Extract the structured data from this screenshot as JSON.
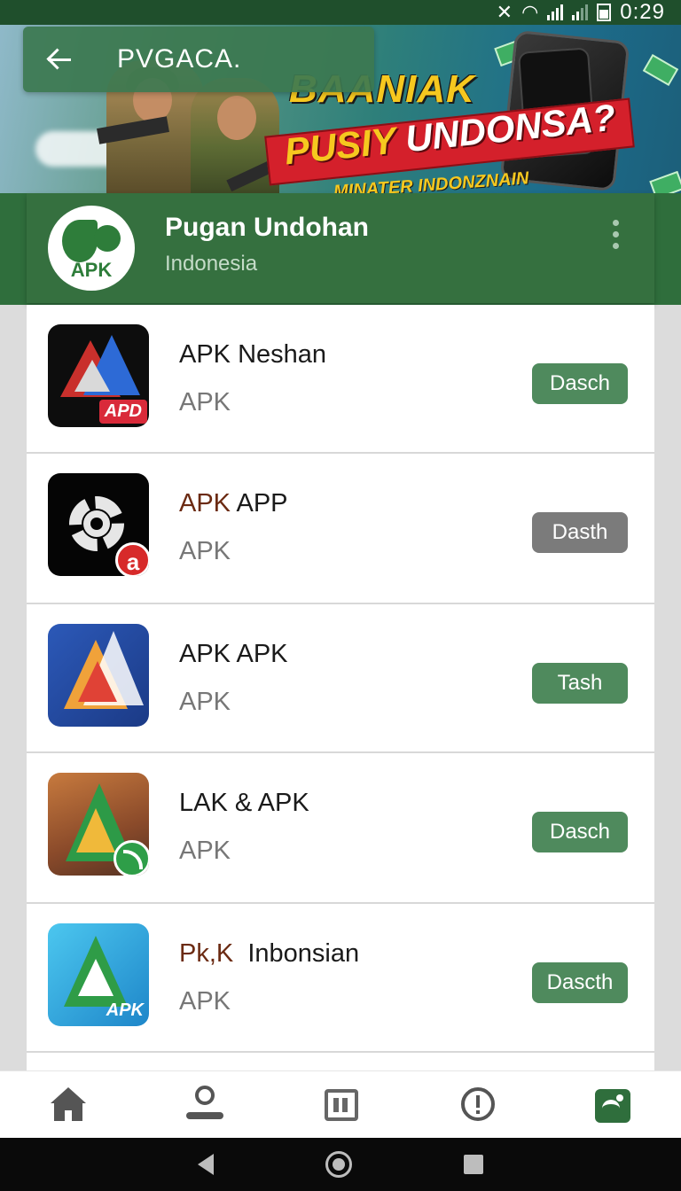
{
  "status_bar": {
    "time": "0:29",
    "icons": [
      "mute-icon",
      "wifi-icon",
      "signal-icon",
      "signal-icon",
      "battery-icon"
    ]
  },
  "top_bar": {
    "back_icon": "arrow-left-icon",
    "title": "PVGACA."
  },
  "banner": {
    "headline_1": "BAANIAK",
    "headline_2_prefix": "PUSIY",
    "headline_2_rest": " UNDONSA?",
    "headline_3": "MINATER INDONZNAIN"
  },
  "profile": {
    "logo_text": "APK",
    "name": "Pugan Undohan",
    "subtitle": "Indonesia",
    "menu_icon": "more-vertical-icon"
  },
  "apps": [
    {
      "name": "APK Neshan",
      "name_prefix": "",
      "sub": "APK",
      "button": "Dasch",
      "button_color": "#4f8a5d",
      "icon_badge": "APD"
    },
    {
      "name": " APP",
      "name_prefix": "APK",
      "sub": "APK",
      "button": "Dasth",
      "button_color": "#7b7b7b",
      "icon_badge": "a"
    },
    {
      "name": "APK APK",
      "name_prefix": "",
      "sub": "APK",
      "button": "Tash",
      "button_color": "#4f8a5d",
      "icon_badge": ""
    },
    {
      "name": "LAK & APK",
      "name_prefix": "",
      "sub": "APK",
      "button": "Dasch",
      "button_color": "#4f8a5d",
      "icon_badge": ""
    },
    {
      "name": "  Inbonsian",
      "name_prefix": "Pk,K",
      "sub": "APK",
      "button": "Dascth",
      "button_color": "#4f8a5d",
      "icon_badge": "APK"
    }
  ],
  "bottom_nav": {
    "items": [
      "home-icon",
      "profile-icon",
      "calendar-icon",
      "alert-icon",
      "store-icon"
    ],
    "active": "store-icon"
  },
  "system_nav": [
    "back-icon",
    "home-icon",
    "recents-icon"
  ],
  "colors": {
    "primary_green": "#2f6e3c",
    "button_green": "#4f8a5d",
    "button_grey": "#7b7b7b",
    "accent_yellow": "#f6c81f",
    "accent_red": "#d4202b"
  }
}
